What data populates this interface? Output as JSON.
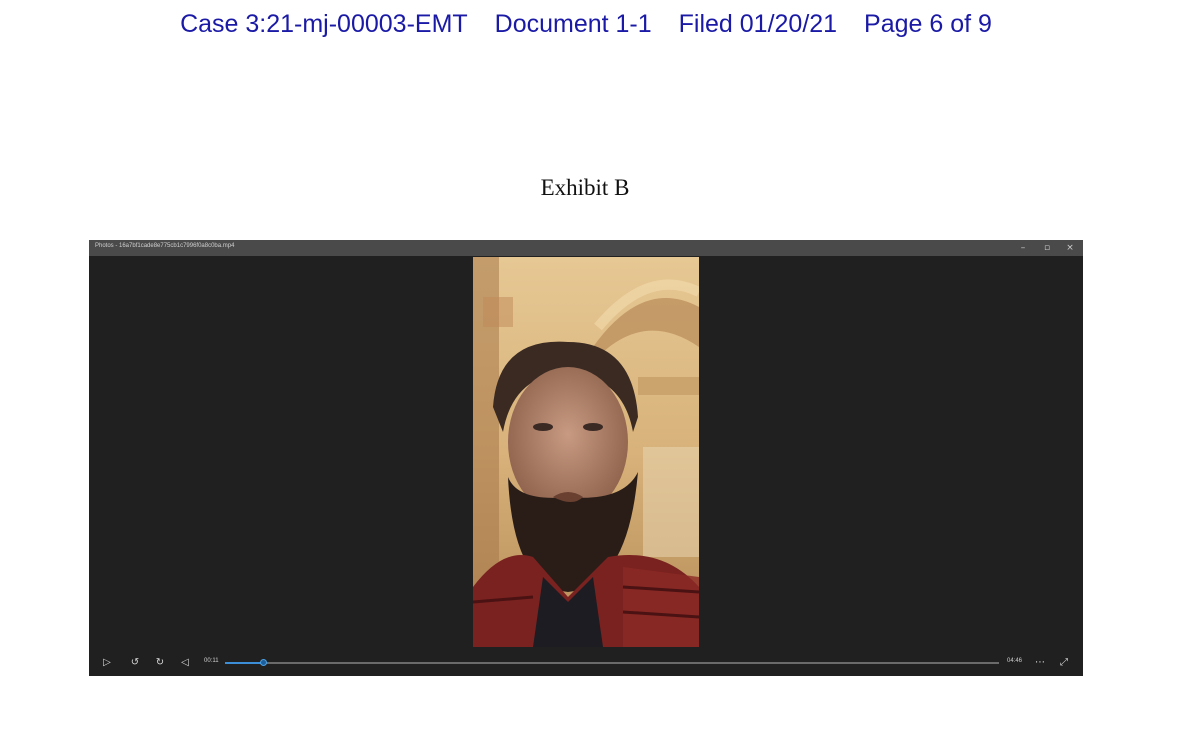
{
  "header": {
    "case": "Case 3:21-mj-00003-EMT",
    "document": "Document 1-1",
    "filed": "Filed 01/20/21",
    "page": "Page 6 of 9"
  },
  "exhibit": {
    "title": "Exhibit B"
  },
  "player": {
    "window_title": "Photos - 16a7bf1cade8e775cb1c7996f0a8c0ba.mp4",
    "current_time": "00:11",
    "duration": "04:46",
    "progress_fraction": 0.05,
    "accent_color": "#3c8fd6",
    "icons": {
      "minimize": "minimize-icon",
      "maximize": "maximize-icon",
      "close": "close-icon",
      "play": "play-icon",
      "rewind": "rewind-icon",
      "forward": "forward-icon",
      "volume": "volume-icon",
      "more": "more-options-icon",
      "fullscreen": "fullscreen-icon"
    }
  }
}
